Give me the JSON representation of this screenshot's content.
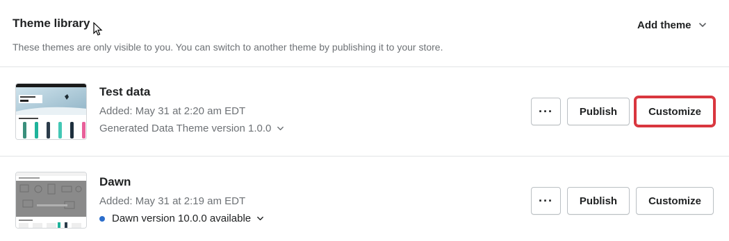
{
  "header": {
    "title": "Theme library",
    "subtitle": "These themes are only visible to you. You can switch to another theme by publishing it to your store.",
    "add_theme_label": "Add theme"
  },
  "themes": [
    {
      "name": "Test data",
      "added": "Added: May 31 at 2:20 am EDT",
      "version": "Generated Data Theme version 1.0.0",
      "more_label": "···",
      "publish_label": "Publish",
      "customize_label": "Customize",
      "customize_highlighted": true
    },
    {
      "name": "Dawn",
      "added": "Added: May 31 at 2:19 am EDT",
      "version": "Dawn version 10.0.0 available",
      "update_dot_color": "#2c6ecb",
      "more_label": "···",
      "publish_label": "Publish",
      "customize_label": "Customize",
      "customize_highlighted": false
    }
  ],
  "colors": {
    "highlight": "#d9363e",
    "border": "#babfc3",
    "divider": "#e1e3e5",
    "subdued_text": "#6d7175"
  }
}
